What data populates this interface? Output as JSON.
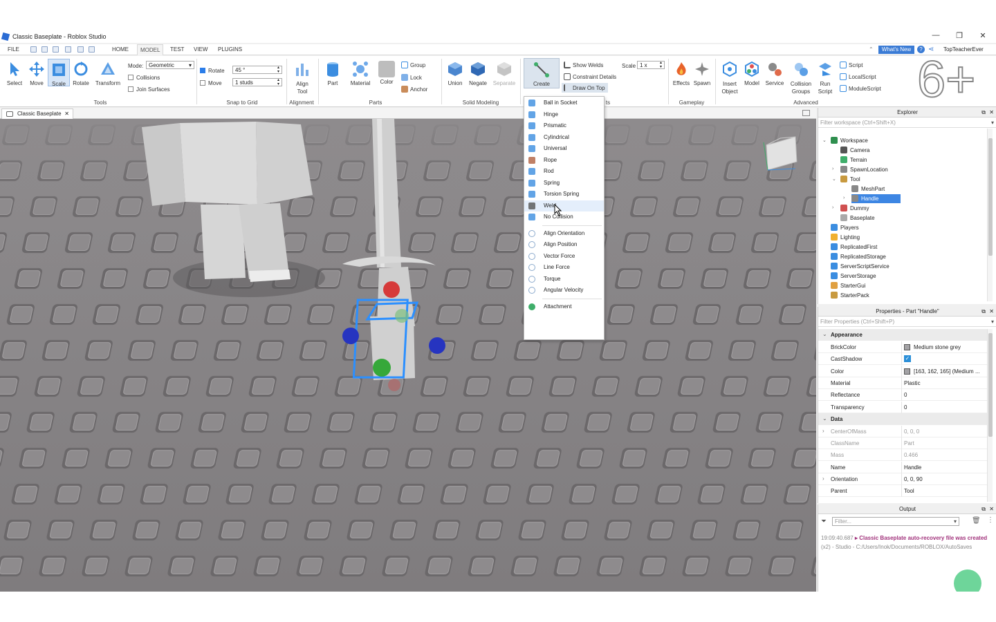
{
  "window": {
    "title": "Classic Baseplate - Roblox Studio",
    "minimize": "—",
    "maximize": "❐",
    "close": "✕"
  },
  "menubar": {
    "file": "FILE",
    "home": "HOME",
    "model": "MODEL",
    "test": "TEST",
    "view": "VIEW",
    "plugins": "PLUGINS",
    "whats_new": "What's New",
    "user": "TopTeacherEver"
  },
  "ribbon": {
    "tools": {
      "select": "Select",
      "move": "Move",
      "scale": "Scale",
      "rotate": "Rotate",
      "transform": "Transform",
      "group_label": "Tools"
    },
    "mode": {
      "label": "Mode:",
      "value": "Geometric",
      "collisions": "Collisions",
      "join_surfaces": "Join Surfaces"
    },
    "snap": {
      "rotate_label": "Rotate",
      "rotate_value": "45 °",
      "move_label": "Move",
      "move_value": "1 studs",
      "group_label": "Snap to Grid"
    },
    "alignment": {
      "align_tool": "Align Tool",
      "group_label": "Alignment"
    },
    "parts": {
      "part": "Part",
      "material": "Material",
      "color": "Color",
      "group": "Group",
      "lock": "Lock",
      "anchor": "Anchor",
      "group_label": "Parts"
    },
    "solid": {
      "union": "Union",
      "negate": "Negate",
      "separate": "Separate",
      "group_label": "Solid Modeling"
    },
    "constraints": {
      "create": "Create",
      "show_welds": "Show Welds",
      "constraint_details": "Constraint Details",
      "draw_on_top": "Draw On Top",
      "scale_label": "Scale",
      "scale_value": "1 x",
      "group_label_tail": "ts"
    },
    "gameplay": {
      "effects": "Effects",
      "spawn": "Spawn",
      "group_label": "Gameplay"
    },
    "advanced": {
      "insert_object": "Insert Object",
      "model": "Model",
      "service": "Service",
      "collision_groups": "Collision Groups",
      "run_script": "Run Script",
      "script": "Script",
      "local_script": "LocalScript",
      "module_script": "ModuleScript",
      "group_label": "Advanced"
    },
    "overlay_text": "6+"
  },
  "doc_tab": {
    "label": "Classic Baseplate"
  },
  "create_menu": {
    "items": [
      "Ball in Socket",
      "Hinge",
      "Prismatic",
      "Cylindrical",
      "Universal",
      "Rope",
      "Rod",
      "Spring",
      "Torsion Spring",
      "Weld",
      "No Collision"
    ],
    "items2": [
      "Align Orientation",
      "Align Position",
      "Vector Force",
      "Line Force",
      "Torque",
      "Angular Velocity"
    ],
    "items3": [
      "Attachment"
    ],
    "hovered": "Weld"
  },
  "explorer": {
    "title": "Explorer",
    "filter_placeholder": "Filter workspace (Ctrl+Shift+X)",
    "tree": {
      "workspace": "Workspace",
      "camera": "Camera",
      "terrain": "Terrain",
      "spawn": "SpawnLocation",
      "tool": "Tool",
      "meshpart": "MeshPart",
      "handle": "Handle",
      "dummy": "Dummy",
      "baseplate": "Baseplate",
      "players": "Players",
      "lighting": "Lighting",
      "replicated_first": "ReplicatedFirst",
      "replicated_storage": "ReplicatedStorage",
      "server_script_service": "ServerScriptService",
      "server_storage": "ServerStorage",
      "starter_gui": "StarterGui",
      "starter_pack": "StarterPack"
    }
  },
  "properties": {
    "title": "Properties - Part \"Handle\"",
    "filter_placeholder": "Filter Properties (Ctrl+Shift+P)",
    "appearance": "Appearance",
    "rows_appearance": [
      {
        "k": "BrickColor",
        "v": "Medium stone grey"
      },
      {
        "k": "CastShadow",
        "v": ""
      },
      {
        "k": "Color",
        "v": "[163, 162, 165] (Medium ..."
      },
      {
        "k": "Material",
        "v": "Plastic"
      },
      {
        "k": "Reflectance",
        "v": "0"
      },
      {
        "k": "Transparency",
        "v": "0"
      }
    ],
    "data": "Data",
    "rows_data": [
      {
        "k": "CenterOfMass",
        "v": "0, 0, 0"
      },
      {
        "k": "ClassName",
        "v": "Part"
      },
      {
        "k": "Mass",
        "v": "0.466"
      },
      {
        "k": "Name",
        "v": "Handle"
      },
      {
        "k": "Orientation",
        "v": "0, 0, 90"
      },
      {
        "k": "Parent",
        "v": "Tool"
      }
    ]
  },
  "output": {
    "title": "Output",
    "filter_placeholder": "Filter...",
    "timestamp": "19:09:40.687",
    "message": "▸ Classic Baseplate auto-recovery file was created",
    "detail": "(x2) - Studio - C:/Users/Inok/Documents/ROBLOX/AutoSaves"
  },
  "colors": {
    "accent": "#3d86e3",
    "selection": "#2b8fff",
    "baseplate": "#8a8789"
  }
}
